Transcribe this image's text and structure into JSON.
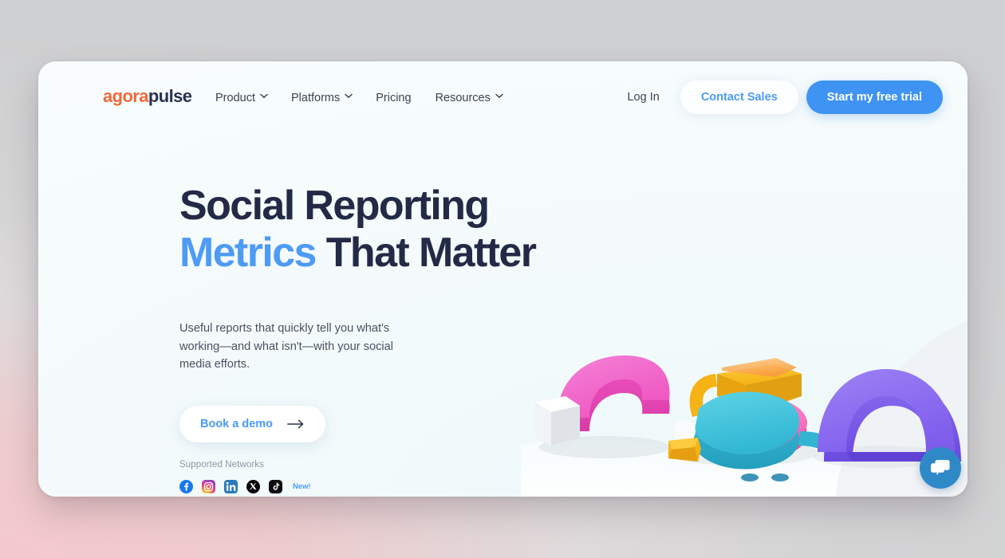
{
  "brand": {
    "logo_part1": "agora",
    "logo_part2": "pulse",
    "orange": "#ee6a3a",
    "navy": "#2a3250",
    "blue": "#4b9bf5"
  },
  "nav": {
    "links": [
      {
        "label": "Product",
        "has_caret": true
      },
      {
        "label": "Platforms",
        "has_caret": true
      },
      {
        "label": "Pricing",
        "has_caret": false
      },
      {
        "label": "Resources",
        "has_caret": true
      }
    ],
    "login_label": "Log In",
    "contact_sales_label": "Contact Sales",
    "trial_label": "Start my free trial"
  },
  "hero": {
    "heading_line1": "Social Reporting",
    "heading_line2_highlight": "Metrics",
    "heading_line2_rest": " That Matter",
    "paragraph": "Useful reports that quickly tell you what's working—and what isn't—with your social media efforts.",
    "cta_label": "Book a demo"
  },
  "supported": {
    "label": "Supported Networks",
    "networks": [
      {
        "name": "facebook",
        "color": "#1877f2"
      },
      {
        "name": "instagram",
        "color": "#d6277f"
      },
      {
        "name": "linkedin",
        "color": "#2a7ab9"
      },
      {
        "name": "x-twitter",
        "color": "#050505"
      },
      {
        "name": "tiktok",
        "color": "#0c0c0c"
      }
    ],
    "badge": "New!"
  },
  "illustration": {
    "colors": {
      "pink_donut": "#f061c6",
      "white_block": "#f3f3f5",
      "cyan_pie": "#3cbfd9",
      "pink_pie": "#f86dbe",
      "yellow_block": "#f7bb1e",
      "orange_top": "#f79b3c",
      "purple_arch": "#8a6cf0"
    }
  },
  "chat": {
    "tooltip": "chat"
  }
}
